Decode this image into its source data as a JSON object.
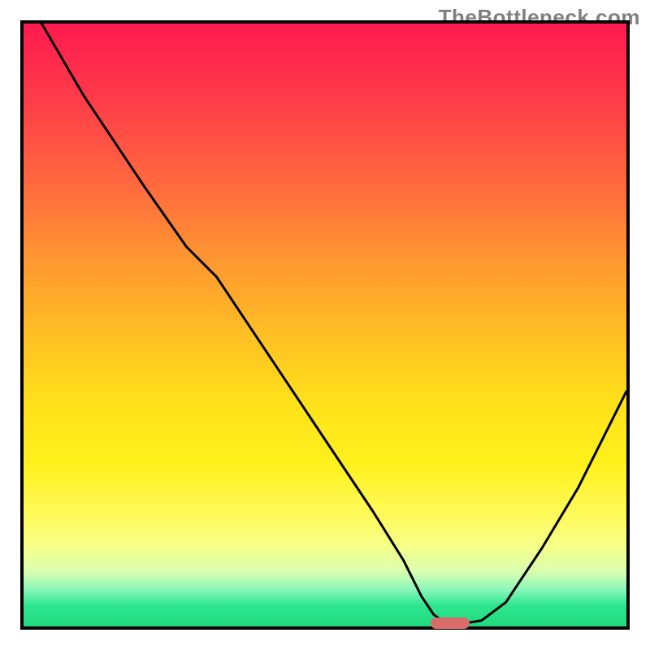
{
  "watermark": "TheBottleneck.com",
  "chart_data": {
    "type": "line",
    "title": "",
    "xlabel": "",
    "ylabel": "",
    "xlim": [
      0,
      100
    ],
    "ylim": [
      0,
      100
    ],
    "grid": false,
    "legend": false,
    "series": [
      {
        "name": "bottleneck-curve",
        "x": [
          3,
          10,
          20,
          27,
          32,
          40,
          50,
          58,
          63,
          66,
          68,
          70,
          73,
          76,
          80,
          86,
          92,
          100
        ],
        "y": [
          100,
          88,
          73,
          63,
          58,
          46,
          31,
          19,
          11,
          5,
          2,
          0.5,
          0.5,
          1,
          4,
          13,
          23,
          39
        ]
      }
    ],
    "optimum_marker": {
      "x_start": 67.5,
      "x_end": 74,
      "y": 0.5,
      "color": "#d96b6b"
    },
    "background_gradient": {
      "stops": [
        {
          "pos": 0,
          "color": "#ff1a4f"
        },
        {
          "pos": 0.12,
          "color": "#ff3a4a"
        },
        {
          "pos": 0.27,
          "color": "#ff6a3e"
        },
        {
          "pos": 0.4,
          "color": "#ff9a30"
        },
        {
          "pos": 0.52,
          "color": "#ffc024"
        },
        {
          "pos": 0.63,
          "color": "#ffe11a"
        },
        {
          "pos": 0.73,
          "color": "#fff11c"
        },
        {
          "pos": 0.82,
          "color": "#fffb60"
        },
        {
          "pos": 0.87,
          "color": "#f4ff8a"
        },
        {
          "pos": 0.91,
          "color": "#d8ffb0"
        },
        {
          "pos": 0.94,
          "color": "#86f6ba"
        },
        {
          "pos": 0.965,
          "color": "#2ee68e"
        },
        {
          "pos": 1.0,
          "color": "#22d97f"
        }
      ]
    }
  }
}
